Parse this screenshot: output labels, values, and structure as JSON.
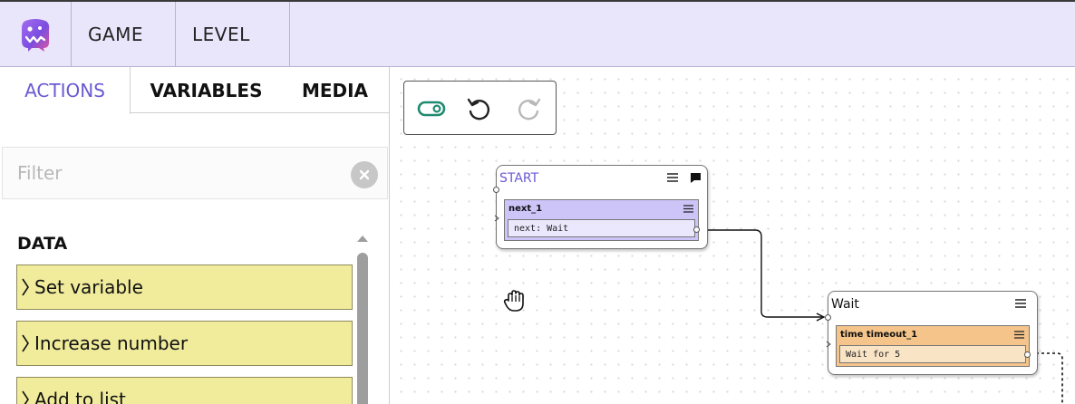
{
  "topbar": {
    "logo_icon": "app-monster-logo",
    "tabs": [
      {
        "label": "GAME"
      },
      {
        "label": "LEVEL"
      }
    ]
  },
  "panel": {
    "tabs": [
      {
        "label": "ACTIONS",
        "active": true
      },
      {
        "label": "VARIABLES",
        "active": false
      },
      {
        "label": "MEDIA",
        "active": false
      }
    ],
    "filter": {
      "placeholder": "Filter",
      "value": ""
    },
    "section": {
      "title": "DATA"
    },
    "items": [
      {
        "label": "Set variable"
      },
      {
        "label": "Increase number"
      },
      {
        "label": "Add to list"
      }
    ]
  },
  "canvas": {
    "toolbar": {
      "toggle_icon": "toggle-icon",
      "undo_icon": "undo-icon",
      "redo_icon": "redo-icon"
    },
    "nodes": [
      {
        "title": "START",
        "slot_title": "next_1",
        "slot_value": "next: Wait"
      },
      {
        "title": "Wait",
        "slot_title": "time timeout_1",
        "slot_value": "Wait for 5"
      }
    ]
  },
  "colors": {
    "accent": "#6a5ad2",
    "topbar_bg": "#e9e5fb",
    "action_item_bg": "#f1ec9c",
    "start_slot_bg": "#cdc4f8",
    "wait_slot_bg": "#f4c48a",
    "toggle_color": "#1f8a70"
  }
}
